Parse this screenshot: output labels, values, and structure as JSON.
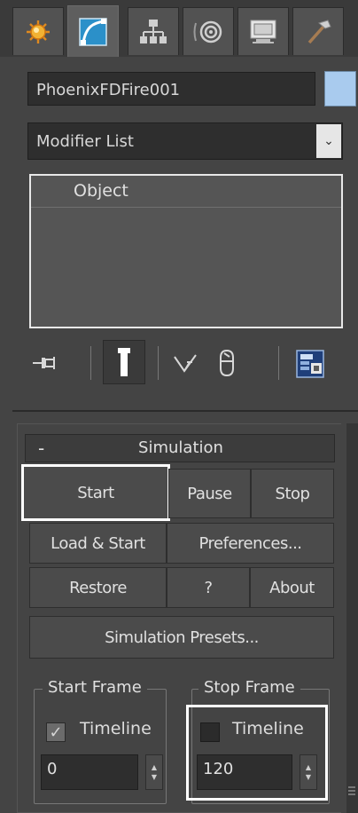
{
  "tabs": [
    {
      "icon": "sun-icon",
      "label": "Create"
    },
    {
      "icon": "modify-curve-icon",
      "label": "Modify"
    },
    {
      "icon": "hierarchy-icon",
      "label": "Hierarchy"
    },
    {
      "icon": "motion-icon",
      "label": "Motion"
    },
    {
      "icon": "display-monitor-icon",
      "label": "Display"
    },
    {
      "icon": "hammer-icon",
      "label": "Utilities"
    }
  ],
  "object_name": "PhoenixFDFire001",
  "object_color": "#a9cbee",
  "modifier_list": {
    "value": "Modifier List",
    "arrow": "⌄"
  },
  "stack": {
    "items": [
      "Object"
    ]
  },
  "modifier_toolbar": [
    {
      "icon": "pin-stack-icon"
    },
    {
      "icon": "show-end-result-icon"
    },
    {
      "icon": "make-unique-icon"
    },
    {
      "icon": "remove-modifier-icon"
    },
    {
      "icon": "configure-modifier-sets-icon"
    }
  ],
  "simulation": {
    "collapse_symbol": "-",
    "title": "Simulation",
    "buttons": {
      "start": "Start",
      "pause": "Pause",
      "stop": "Stop",
      "load_start": "Load & Start",
      "preferences": "Preferences...",
      "restore": "Restore",
      "help": "?",
      "about": "About",
      "presets": "Simulation Presets..."
    },
    "start_frame": {
      "title": "Start Frame",
      "timeline_label": "Timeline",
      "timeline_checked": true,
      "value": "0"
    },
    "stop_frame": {
      "title": "Stop Frame",
      "timeline_label": "Timeline",
      "timeline_checked": false,
      "value": "120"
    }
  }
}
